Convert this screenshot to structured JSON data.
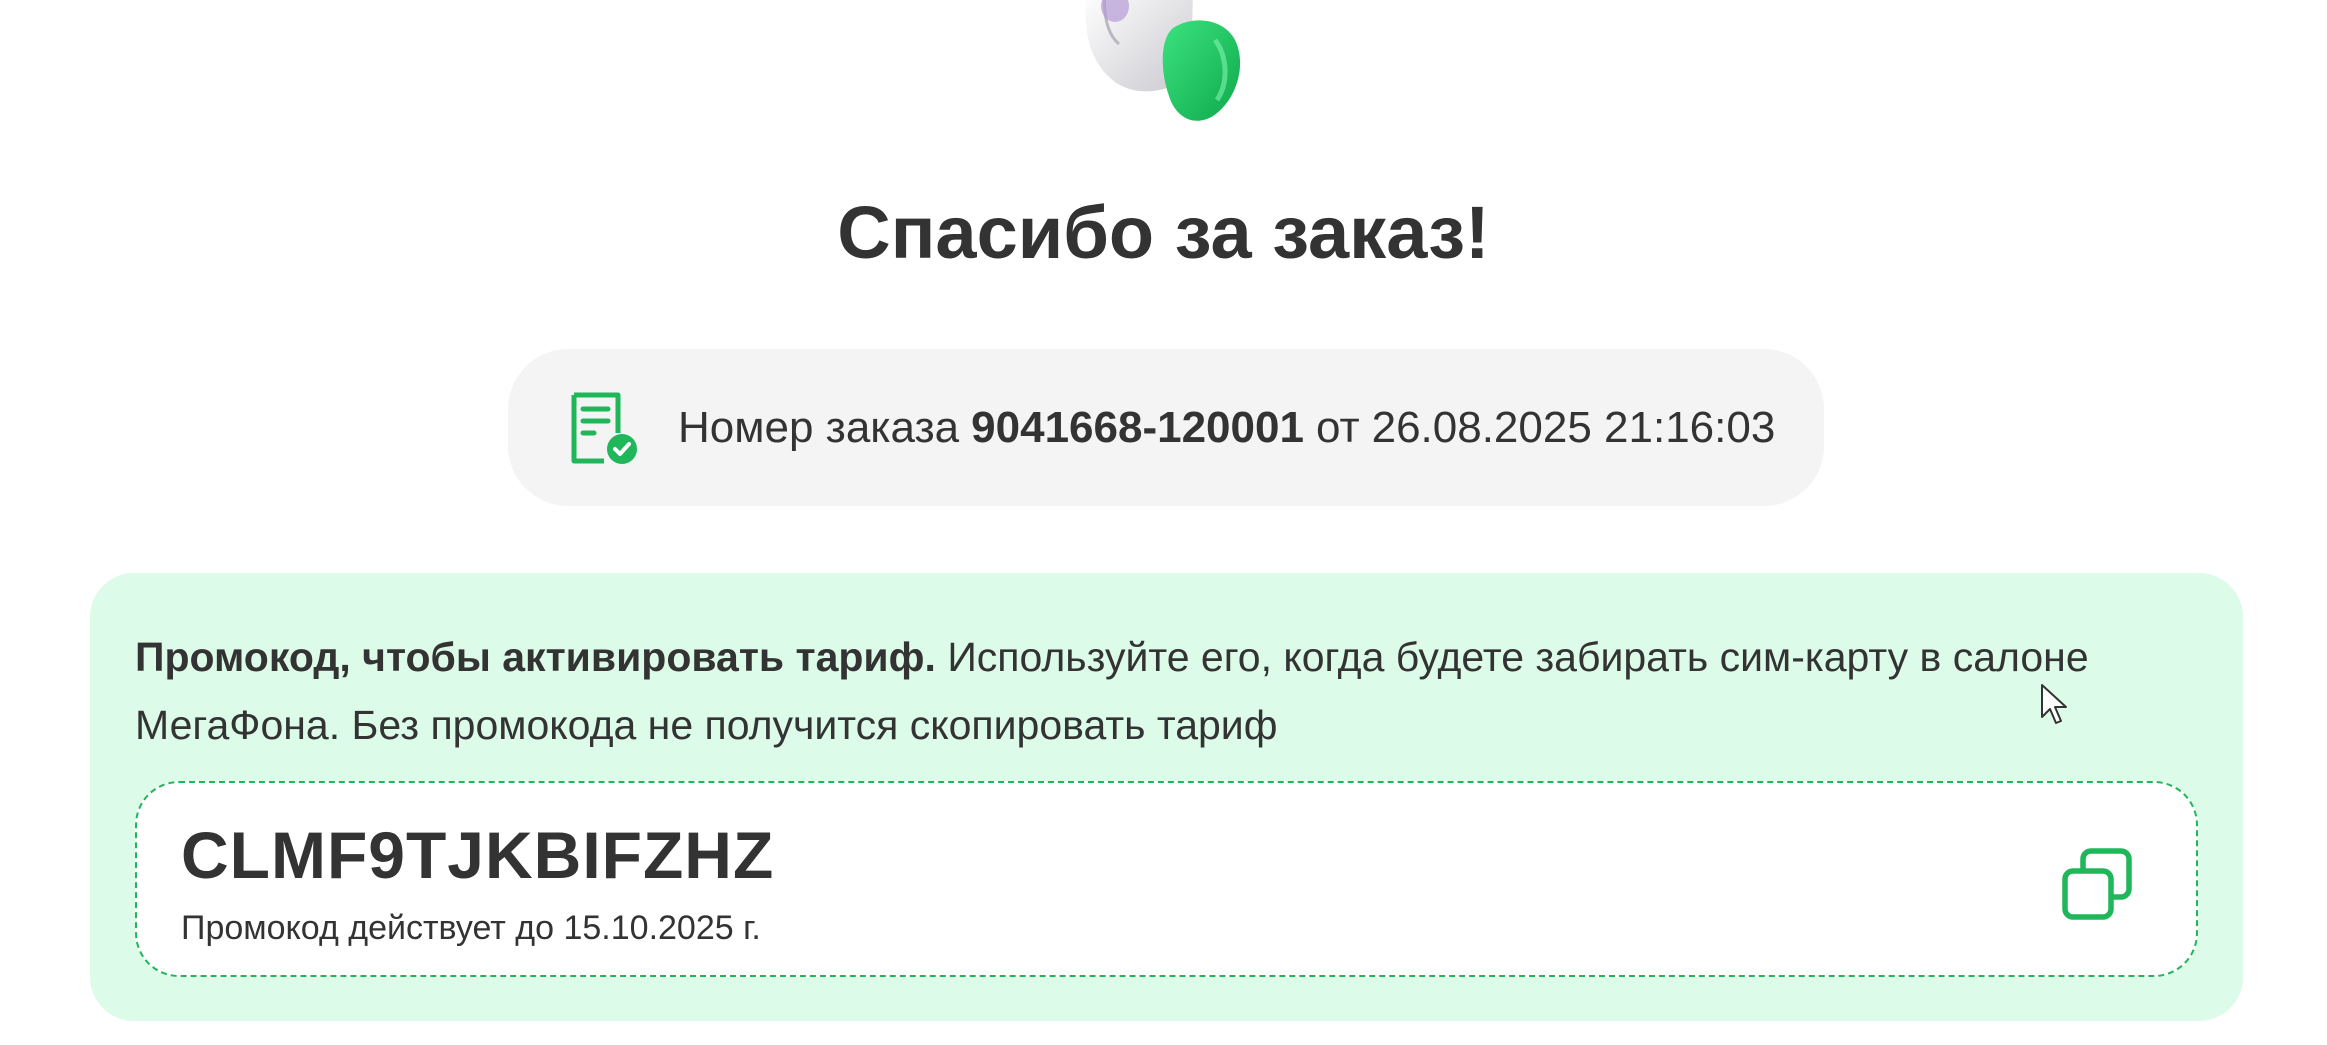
{
  "title": "Спасибо за заказ!",
  "order": {
    "label": "Номер заказа",
    "number": "9041668-120001",
    "date_prefix": "от",
    "date": "26.08.2025 21:16:03"
  },
  "promo": {
    "desc_bold": "Промокод, чтобы активировать тариф.",
    "desc_text": "Используйте его, когда будете забирать сим-карту в салоне МегаФона. Без промокода не получится скопировать тариф",
    "code": "CLMF9TJKBIFZHZ",
    "valid_until": "Промокод действует до 15.10.2025 г."
  },
  "icons": {
    "hand": "waving-hand-icon",
    "order": "receipt-check-icon",
    "copy": "copy-icon",
    "cursor": "mouse-cursor-icon"
  },
  "colors": {
    "accent": "#1fb75a",
    "card_bg": "#dcfbe8",
    "pill_bg": "#f4f4f4",
    "text": "#333333"
  }
}
